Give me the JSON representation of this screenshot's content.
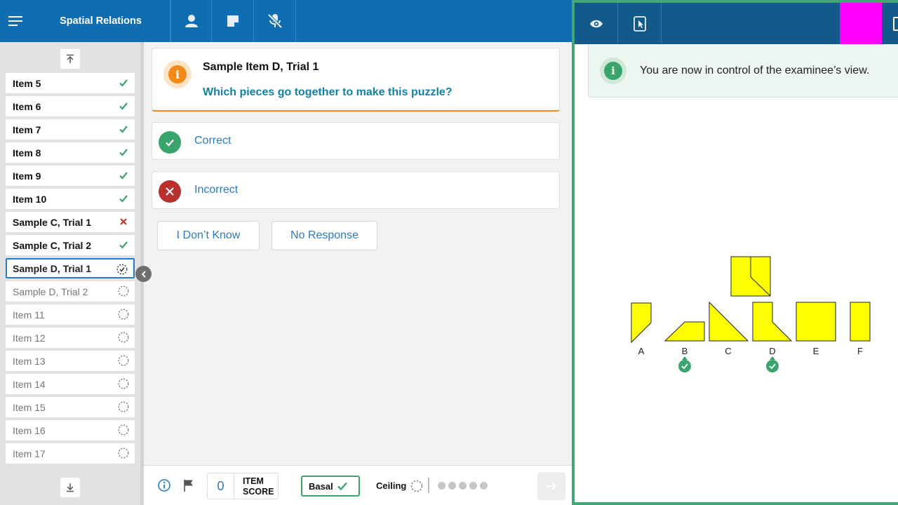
{
  "app": {
    "title": "Spatial Relations"
  },
  "toolbar": {
    "icons": [
      "menu-icon",
      "person-icon",
      "note-icon",
      "mic-off-icon"
    ]
  },
  "sidebar": {
    "items": [
      {
        "label": "Item 5",
        "status": "correct"
      },
      {
        "label": "Item 6",
        "status": "correct"
      },
      {
        "label": "Item 7",
        "status": "correct"
      },
      {
        "label": "Item 8",
        "status": "correct"
      },
      {
        "label": "Item 9",
        "status": "correct"
      },
      {
        "label": "Item 10",
        "status": "correct"
      },
      {
        "label": "Sample C, Trial 1",
        "status": "incorrect"
      },
      {
        "label": "Sample C, Trial 2",
        "status": "correct"
      },
      {
        "label": "Sample D, Trial 1",
        "status": "current"
      },
      {
        "label": "Sample D, Trial 2",
        "status": "pending"
      },
      {
        "label": "Item 11",
        "status": "pending"
      },
      {
        "label": "Item 12",
        "status": "pending"
      },
      {
        "label": "Item 13",
        "status": "pending"
      },
      {
        "label": "Item 14",
        "status": "pending"
      },
      {
        "label": "Item 15",
        "status": "pending"
      },
      {
        "label": "Item 16",
        "status": "pending"
      },
      {
        "label": "Item 17",
        "status": "pending"
      }
    ]
  },
  "question": {
    "title": "Sample Item D, Trial 1",
    "prompt": "Which pieces go together to make this puzzle?"
  },
  "answers": {
    "correct_label": "Correct",
    "incorrect_label": "Incorrect"
  },
  "responses": {
    "dont_know_label": "I Don’t Know",
    "no_response_label": "No Response"
  },
  "footer": {
    "item_score_value": "0",
    "item_score_label_1": "ITEM",
    "item_score_label_2": "SCORE",
    "basal_label": "Basal",
    "ceiling_label": "Ceiling",
    "ceiling_dots": 5
  },
  "examinee_view": {
    "banner_text": "You are now in control of the examinee’s view.",
    "piece_labels": [
      "A",
      "B",
      "C",
      "D",
      "E",
      "F"
    ],
    "selected_pieces": [
      "B",
      "D"
    ]
  },
  "colors": {
    "primary_blue": "#0e6eb1",
    "right_header": "#115a8a",
    "success_green": "#3aa56b",
    "error_red": "#b8312f",
    "accent_orange": "#f08a24",
    "puzzle_yellow": "#ffff00",
    "marker_magenta": "#ff00ff"
  }
}
